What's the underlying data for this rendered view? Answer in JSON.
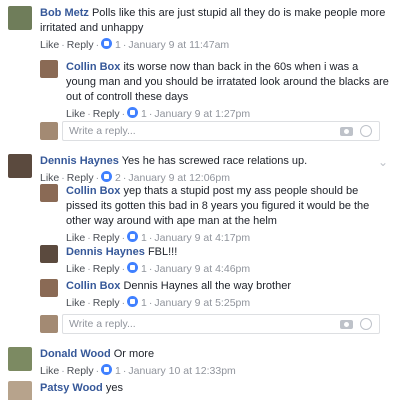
{
  "comments": [
    {
      "name": "Bob Metz",
      "text": "Polls like this are just stupid all they do is make people more irritated and unhappy",
      "like": "Like",
      "reply": "Reply",
      "count": "1",
      "time": "January 9 at 11:47am",
      "avatar_color": "#6f7d5a"
    },
    {
      "name": "Collin Box",
      "text": "its worse now than back in the 60s when i was a young man and you should be irratated look around the blacks are out of controll these days",
      "like": "Like",
      "reply": "Reply",
      "count": "1",
      "time": "January 9 at 1:27pm",
      "avatar_color": "#8a6a55"
    },
    {
      "name": "Dennis Haynes",
      "text": "Yes he has screwed race relations up.",
      "like": "Like",
      "reply": "Reply",
      "count": "2",
      "time": "January 9 at 12:06pm",
      "avatar_color": "#5b4a3e"
    },
    {
      "name": "Collin Box",
      "text": "yep thats a stupid post my ass people should be pissed its gotten this bad in 8 years you figured it would be the other way around with ape man at the helm",
      "like": "Like",
      "reply": "Reply",
      "count": "1",
      "time": "January 9 at 4:17pm",
      "avatar_color": "#8a6a55"
    },
    {
      "name": "Dennis Haynes",
      "text": "FBL!!!",
      "like": "Like",
      "reply": "Reply",
      "count": "1",
      "time": "January 9 at 4:46pm",
      "avatar_color": "#5b4a3e"
    },
    {
      "name": "Collin Box",
      "text": "Dennis Haynes all the way brother",
      "like": "Like",
      "reply": "Reply",
      "count": "1",
      "time": "January 9 at 5:25pm",
      "avatar_color": "#8a6a55"
    },
    {
      "name": "Donald Wood",
      "text": "Or more",
      "like": "Like",
      "reply": "Reply",
      "count": "1",
      "time": "January 10 at 12:33pm",
      "avatar_color": "#7c8a62"
    },
    {
      "name": "Patsy Wood",
      "text": "yes",
      "avatar_color": "#b7a38c"
    }
  ],
  "reply_box": {
    "placeholder": "Write a reply...",
    "avatar_color": "#a38a73"
  },
  "colors": {
    "name": "#365899",
    "meta": "#90949c",
    "like_badge": "#4080ff"
  }
}
